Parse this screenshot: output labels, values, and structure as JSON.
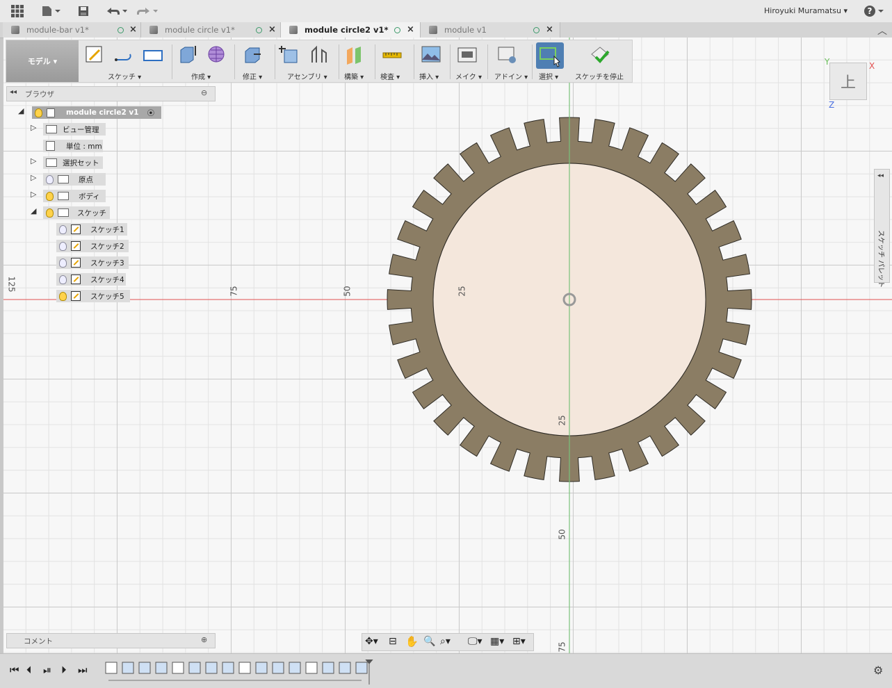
{
  "user": {
    "name": "Hiroyuki Muramatsu"
  },
  "tabs": [
    {
      "label": "module-bar v1*",
      "active": false
    },
    {
      "label": "module circle v1*",
      "active": false
    },
    {
      "label": "module circle2 v1*",
      "active": true
    },
    {
      "label": "module v1",
      "active": false
    }
  ],
  "toolbar": {
    "mode": "モデル ▾",
    "groups": [
      "スケッチ ▾",
      "作成 ▾",
      "修正 ▾",
      "アセンブリ ▾",
      "構築 ▾",
      "検査 ▾",
      "挿入 ▾",
      "メイク ▾",
      "アドイン ▾",
      "選択 ▾",
      "スケッチを停止"
    ]
  },
  "browser": {
    "title": "ブラウザ",
    "root": "module circle2 v1",
    "items": [
      "ビュー管理",
      "単位 : mm",
      "選択セット",
      "原点",
      "ボディ",
      "スケッチ"
    ],
    "sketches": [
      "スケッチ1",
      "スケッチ2",
      "スケッチ3",
      "スケッチ4",
      "スケッチ5"
    ]
  },
  "comment": {
    "title": "コメント"
  },
  "palette": {
    "title": "スケッチ パレット"
  },
  "viewcube": {
    "face": "上",
    "x": "X",
    "y": "Y",
    "z": "Z"
  },
  "rulers": {
    "horizontal": [
      "125",
      "75",
      "50",
      "25"
    ],
    "vertical": [
      "25",
      "50",
      "75"
    ]
  },
  "colors": {
    "gear": "#8b7d64",
    "inner": "#f4e7dc",
    "x_axis": "#e25050",
    "y_axis": "#7ac27a",
    "select_active": "#4f7fb3"
  }
}
